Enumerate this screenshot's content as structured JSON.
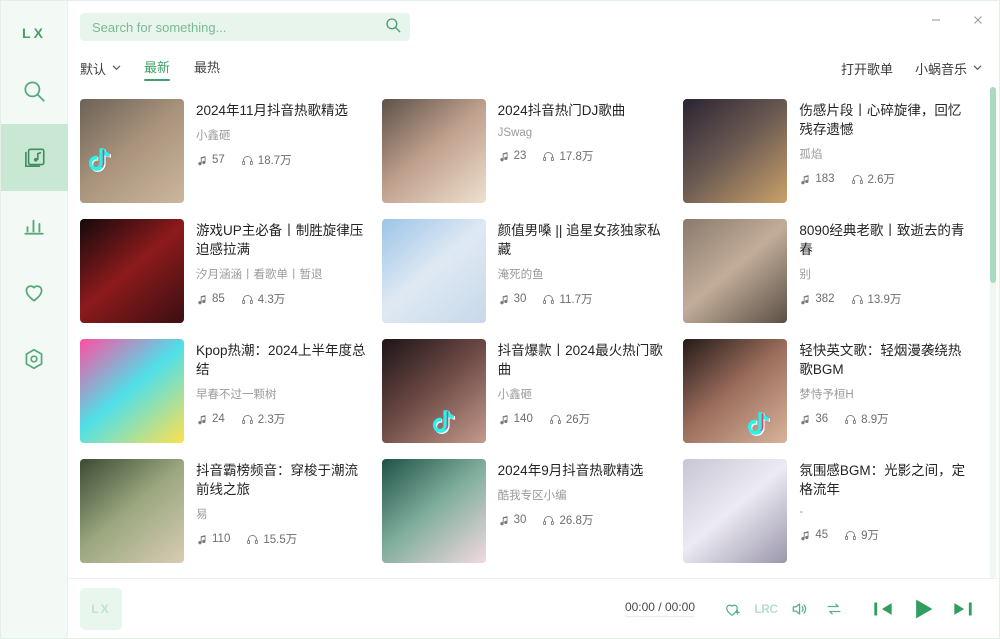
{
  "app": {
    "logo": "LX",
    "player_logo": "LX"
  },
  "window": {
    "minimize": "—",
    "close": "✕"
  },
  "search": {
    "placeholder": "Search for something...",
    "value": "",
    "icon": "search-icon"
  },
  "toolbar": {
    "sort_label": "默认",
    "tabs": [
      {
        "label": "最新",
        "active": true
      },
      {
        "label": "最热",
        "active": false
      }
    ],
    "open_playlist_label": "打开歌单",
    "source_label": "小蜗音乐"
  },
  "sidebar": {
    "items": [
      {
        "name": "search",
        "icon": "search-icon",
        "active": false
      },
      {
        "name": "songlist",
        "icon": "music-list-icon",
        "active": true
      },
      {
        "name": "leaderboard",
        "icon": "bar-chart-icon",
        "active": false
      },
      {
        "name": "favorites",
        "icon": "heart-icon",
        "active": false
      },
      {
        "name": "settings",
        "icon": "settings-icon",
        "active": false
      }
    ]
  },
  "playlists": [
    {
      "title": "2024年11月抖音热歌精选",
      "author": "小鑫砸",
      "song_count": "57",
      "play_count": "18.7万",
      "badge": "tiktok-icon",
      "cover": "girl-peace-sign-stone-wall"
    },
    {
      "title": "2024抖音热门DJ歌曲",
      "author": "JSwag",
      "song_count": "23",
      "play_count": "17.8万",
      "badge": "",
      "cover": "closeup-portrait-warm-light"
    },
    {
      "title": "伤感片段丨心碎旋律，回忆残存遗憾",
      "author": "孤焰",
      "song_count": "183",
      "play_count": "2.6万",
      "badge": "",
      "cover": "anime-girl-golden-sparks"
    },
    {
      "title": "游戏UP主必备丨制胜旋律压迫感拉满",
      "author": "汐月涵涵丨看歌单丨暂退",
      "song_count": "85",
      "play_count": "4.3万",
      "badge": "",
      "cover": "dark-knight-red-moon"
    },
    {
      "title": "颜值男嗓 || 追星女孩独家私藏",
      "author": "淹死的鱼",
      "song_count": "30",
      "play_count": "11.7万",
      "badge": "",
      "cover": "male-singer-microphone-blue"
    },
    {
      "title": "8090经典老歌丨致逝去的青春",
      "author": "别",
      "song_count": "382",
      "play_count": "13.9万",
      "badge": "",
      "cover": "man-glasses-beard-portrait"
    },
    {
      "title": "Kpop热潮：2024上半年度总结",
      "author": "早春不过一颗树",
      "song_count": "24",
      "play_count": "2.3万",
      "badge": "",
      "cover": "kpop-idol-pink-neon"
    },
    {
      "title": "抖音爆款丨2024最火热门歌曲",
      "author": "小鑫砸",
      "song_count": "140",
      "play_count": "26万",
      "badge": "tiktok-icon",
      "cover": "girl-resting-hand-dark"
    },
    {
      "title": "轻快英文歌：轻烟漫袭绕热歌BGM",
      "author": "梦恃予桓H",
      "song_count": "36",
      "play_count": "8.9万",
      "badge": "tiktok-icon",
      "cover": "vintage-woman-red-lips"
    },
    {
      "title": "抖音霸榜频音：穿梭于潮流前线之旅",
      "author": "易",
      "song_count": "110",
      "play_count": "15.5万",
      "badge": "",
      "cover": "girl-with-camera-green"
    },
    {
      "title": "2024年9月抖音热歌精选",
      "author": "酷我专区小编",
      "song_count": "30",
      "play_count": "26.8万",
      "badge": "",
      "cover": "girl-with-flowers-teal"
    },
    {
      "title": "氛围感BGM：光影之间，定格流年",
      "author": "-",
      "song_count": "45",
      "play_count": "9万",
      "badge": "",
      "cover": "anime-butterfly-pale"
    }
  ],
  "player": {
    "time": "00:00 / 00:00",
    "lrc_label": "LRC",
    "controls": [
      "heart-plus-icon",
      "lrc-icon",
      "volume-icon",
      "repeat-icon",
      "previous-icon",
      "play-icon",
      "next-icon"
    ]
  },
  "colors": {
    "accent": "#3fa06a",
    "accent_light": "#54b27c",
    "sidebar_bg": "#f3faf6",
    "sidebar_active": "#c9e8d4",
    "search_bg": "#e8f5ed",
    "scrollbar": "#a9dcbf"
  }
}
